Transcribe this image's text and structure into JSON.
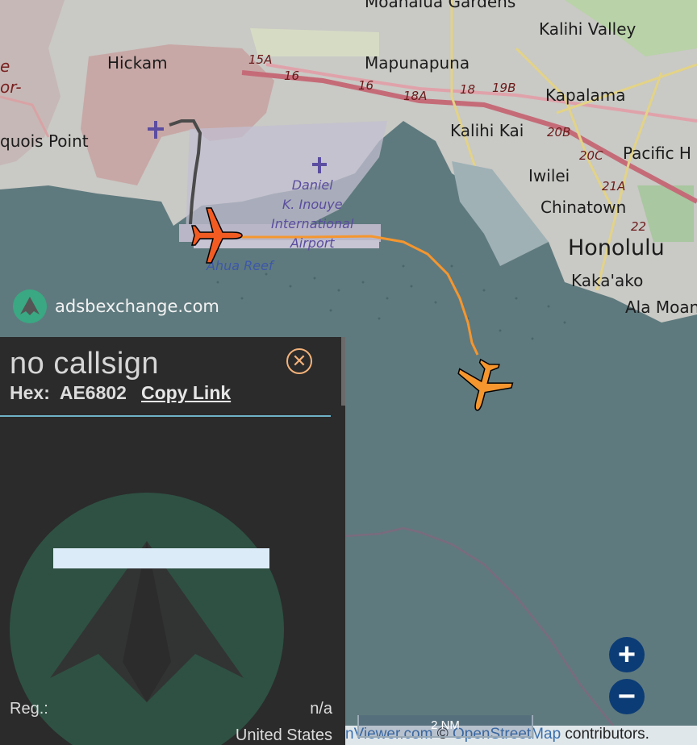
{
  "map": {
    "labels": {
      "moanalua": "Moanalua Gardens",
      "kalihi_valley": "Kalihi Valley",
      "hickam": "Hickam",
      "mapunapuna": "Mapunapuna",
      "kapalama": "Kapalama",
      "quois_point": "quois Point",
      "kalihi_kai": "Kalihi Kai",
      "pacific_h": "Pacific H",
      "iwilei": "Iwilei",
      "chinatown": "Chinatown",
      "honolulu": "Honolulu",
      "kakaako": "Kaka'ako",
      "ala_moana": "Ala Moan",
      "ahua_reef": "Ahua Reef",
      "airport_line1": "Daniel",
      "airport_line2": "K. Inouye",
      "airport_line3": "International",
      "airport_line4": "Airport",
      "left_edge_1": "e",
      "left_edge_2": "or-"
    },
    "road_numbers": {
      "r15a": "15A",
      "r16a": "16",
      "r16b": "16",
      "r18a": "18A",
      "r18": "18",
      "r19b": "19B",
      "r20b": "20B",
      "r20c": "20C",
      "r21a": "21A",
      "r22": "22"
    },
    "brand": "adsbexchange.com",
    "track_colors": {
      "selected": "#f57c20",
      "other": "#f5962e",
      "ground": "#555555"
    }
  },
  "panel": {
    "callsign": "no callsign",
    "hex_label": "Hex:",
    "hex_value": "AE6802",
    "copy_link": "Copy Link",
    "reg_label": "Reg.:",
    "reg_value": "n/a",
    "country": "United States"
  },
  "controls": {
    "zoom_in": "+",
    "zoom_out": "−",
    "close": "✕"
  },
  "scale_bar": {
    "label": "2 NM"
  },
  "attribution": {
    "part1": "nViewer.com",
    "sep": " © ",
    "osm": "OpenStreetMap",
    "part2": " contributors."
  }
}
